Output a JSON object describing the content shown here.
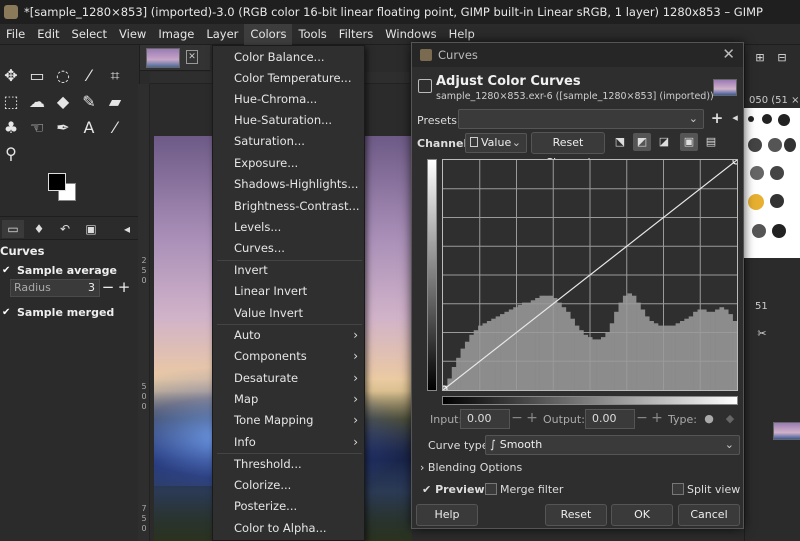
{
  "window": {
    "title": "*[sample_1280×853] (imported)-3.0 (RGB color 16-bit linear floating point, GIMP built-in Linear sRGB, 1 layer) 1280x853 – GIMP"
  },
  "menubar": [
    "File",
    "Edit",
    "Select",
    "View",
    "Image",
    "Layer",
    "Colors",
    "Tools",
    "Filters",
    "Windows",
    "Help"
  ],
  "tool_options": {
    "title": "Curves",
    "sample_average_label": "Sample average",
    "radius_label": "Radius",
    "radius_value": "3",
    "sample_merged_label": "Sample merged"
  },
  "ruler": [
    "2",
    "5",
    "0",
    "5",
    "0",
    "0",
    "7",
    "5",
    "0"
  ],
  "colors_menu": {
    "group1": [
      "Color Balance...",
      "Color Temperature...",
      "Hue-Chroma...",
      "Hue-Saturation...",
      "Saturation...",
      "Exposure...",
      "Shadows-Highlights...",
      "Brightness-Contrast...",
      "Levels...",
      "Curves..."
    ],
    "group2": [
      "Invert",
      "Linear Invert",
      "Value Invert"
    ],
    "group3": [
      "Auto",
      "Components",
      "Desaturate",
      "Map",
      "Tone Mapping",
      "Info"
    ],
    "group4": [
      "Threshold...",
      "Colorize...",
      "Posterize...",
      "Color to Alpha..."
    ]
  },
  "dialog": {
    "title": "Curves",
    "heading": "Adjust Color Curves",
    "subtitle": "sample_1280×853.exr-6 ([sample_1280×853] (imported))",
    "presets_label": "Presets:",
    "channel_label": "Channel:",
    "channel_value": "Value",
    "reset_channel": "Reset Channel",
    "input_label": "Input:",
    "input_value": "0.00",
    "output_label": "Output:",
    "output_value": "0.00",
    "type_label": "Type:",
    "curve_type_label": "Curve type:",
    "curve_type_value": "Smooth",
    "blending_options": "Blending Options",
    "preview_label": "Preview",
    "merge_filter_label": "Merge filter",
    "split_view_label": "Split view",
    "help": "Help",
    "reset": "Reset",
    "ok": "OK",
    "cancel": "Cancel"
  },
  "right_dock": {
    "brushes_label": "050 (51 ×",
    "num": "51"
  },
  "histogram_bins": [
    0.02,
    0.05,
    0.1,
    0.14,
    0.18,
    0.21,
    0.24,
    0.26,
    0.28,
    0.29,
    0.3,
    0.31,
    0.32,
    0.33,
    0.34,
    0.35,
    0.36,
    0.37,
    0.38,
    0.38,
    0.39,
    0.4,
    0.41,
    0.41,
    0.41,
    0.4,
    0.38,
    0.36,
    0.34,
    0.31,
    0.28,
    0.26,
    0.24,
    0.23,
    0.22,
    0.22,
    0.23,
    0.25,
    0.29,
    0.34,
    0.38,
    0.41,
    0.42,
    0.41,
    0.38,
    0.35,
    0.32,
    0.3,
    0.29,
    0.28,
    0.28,
    0.28,
    0.28,
    0.29,
    0.3,
    0.31,
    0.32,
    0.34,
    0.35,
    0.35,
    0.34,
    0.34,
    0.35,
    0.36,
    0.35,
    0.33,
    0.3
  ]
}
